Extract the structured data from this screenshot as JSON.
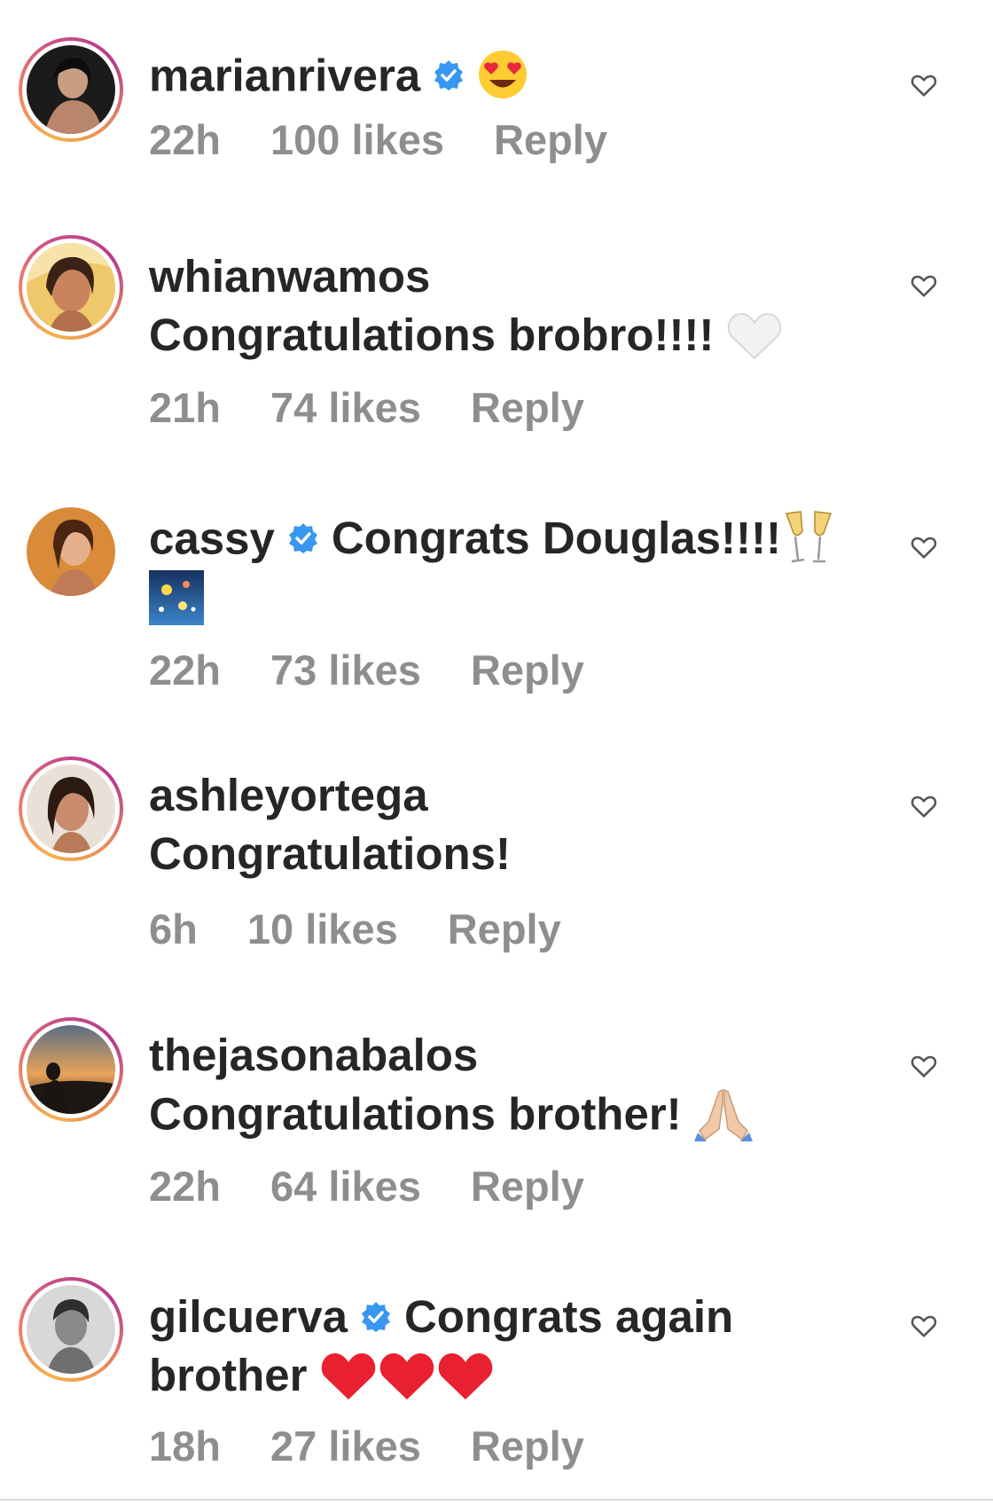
{
  "comments": [
    {
      "username": "marianrivera",
      "verified": true,
      "text": "",
      "emoji_inline": "heart-eyes",
      "time": "22h",
      "likes": "100 likes",
      "reply": "Reply"
    },
    {
      "username": "whianwamos",
      "verified": false,
      "text": "Congratulations brobro!!!!",
      "emoji_inline": "white-heart",
      "time": "21h",
      "likes": "74 likes",
      "reply": "Reply"
    },
    {
      "username": "cassy",
      "verified": true,
      "text": "Congrats Douglas!!!!",
      "text2": "",
      "emoji_inline": "champagne",
      "emoji_line2": "fireworks",
      "time": "22h",
      "likes": "73 likes",
      "reply": "Reply"
    },
    {
      "username": "ashleyortega",
      "verified": false,
      "text": "Congratulations!",
      "time": "6h",
      "likes": "10 likes",
      "reply": "Reply"
    },
    {
      "username": "thejasonabalos",
      "verified": false,
      "text": "Congratulations brother!",
      "emoji_inline": "folded-hands",
      "time": "22h",
      "likes": "64 likes",
      "reply": "Reply"
    },
    {
      "username": "gilcuerva",
      "verified": true,
      "text": "Congrats again",
      "text2": "brother",
      "emoji_line2": "three-red-hearts",
      "time": "18h",
      "likes": "27 likes",
      "reply": "Reply"
    }
  ],
  "colors": {
    "text": "#262626",
    "meta": "#8e8e8e",
    "verified": "#3897f0",
    "ring_start": "#f4b24a",
    "ring_end": "#b83a8d"
  }
}
